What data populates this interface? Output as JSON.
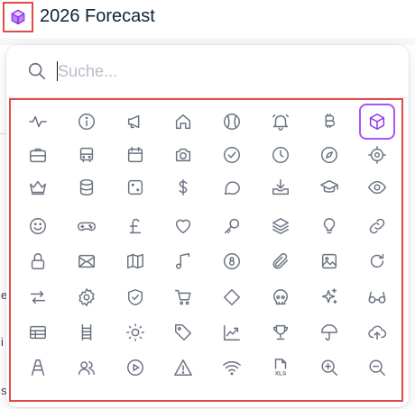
{
  "header": {
    "page_icon": "box-icon",
    "title": "2026 Forecast"
  },
  "search": {
    "placeholder": "Suche...",
    "value": ""
  },
  "background_fragments": [
    "e",
    "i",
    "s"
  ],
  "colors": {
    "highlight_border": "#e24a4a",
    "selected_icon": "#9333ea",
    "icon_stroke": "#6b7280",
    "title_text": "#0f2238"
  },
  "icon_grid": {
    "selected": "box",
    "rows": [
      [
        "activity",
        "info",
        "megaphone",
        "home",
        "baseball",
        "bell-ring",
        "bitcoin",
        "box"
      ],
      [
        "briefcase",
        "bus",
        "calendar",
        "camera",
        "check-circle",
        "clock",
        "compass",
        "crosshair"
      ],
      [
        "crown",
        "database",
        "dice",
        "dollar",
        "message-circle",
        "inbox-download",
        "graduation-cap",
        "eye"
      ],
      [
        "smile",
        "gamepad",
        "pound",
        "heart",
        "key",
        "layers",
        "lightbulb",
        "link"
      ],
      [
        "lock",
        "mail",
        "map",
        "music",
        "eight-ball",
        "paperclip",
        "image",
        "refresh"
      ],
      [
        "swap",
        "settings",
        "shield-check",
        "cart",
        "diamond",
        "skull",
        "sparkles",
        "glasses"
      ],
      [
        "table",
        "ladder",
        "sun",
        "tag",
        "trending-up",
        "trophy",
        "umbrella",
        "cloud-upload"
      ],
      [
        "easel",
        "users",
        "play-circle",
        "alert-triangle",
        "wifi",
        "file-xls",
        "zoom-in",
        "zoom-out"
      ]
    ],
    "file_label": "XLS"
  }
}
